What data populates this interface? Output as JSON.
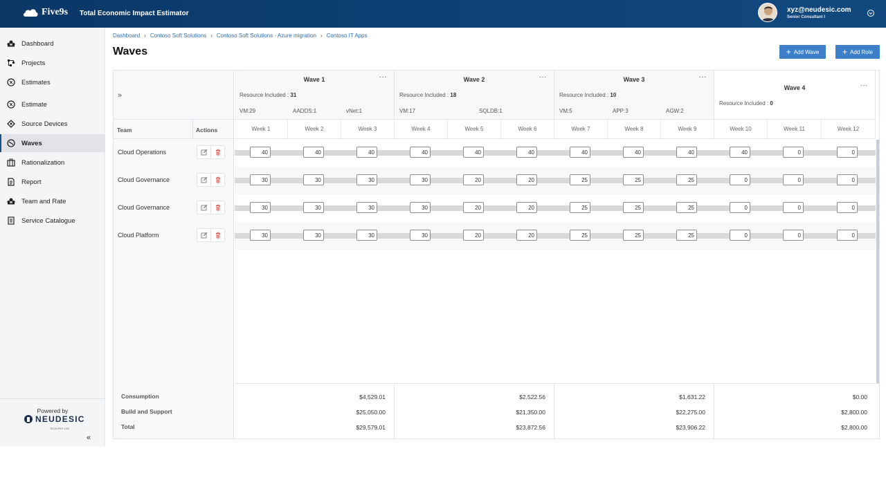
{
  "header": {
    "brand": "Five9s",
    "app_title": "Total Economic Impact Estimator",
    "user_email": "xyz@neudesic.com",
    "user_role": "Senior Consultant I"
  },
  "sidebar": {
    "items": [
      {
        "label": "Dashboard",
        "icon": "dashboard-icon"
      },
      {
        "label": "Projects",
        "icon": "projects-icon"
      },
      {
        "label": "Estimates",
        "icon": "estimates-icon"
      },
      {
        "label": "Estimate",
        "icon": "estimate-icon"
      },
      {
        "label": "Source Devices",
        "icon": "source-devices-icon"
      },
      {
        "label": "Waves",
        "icon": "waves-icon",
        "active": true
      },
      {
        "label": "Rationalization",
        "icon": "rationalization-icon"
      },
      {
        "label": "Report",
        "icon": "report-icon"
      },
      {
        "label": "Team and Rate",
        "icon": "team-icon"
      },
      {
        "label": "Service Catalogue",
        "icon": "catalogue-icon"
      }
    ],
    "powered_by": "Powered by",
    "brand_name": "NEUDESIC",
    "brand_sub": "TECH PVT LTD",
    "collapse": "«"
  },
  "breadcrumb": [
    "Dashboard",
    "Contoso Soft Solutions",
    "Contoso Soft Solutions - Azure migration",
    "Contoso IT Apps"
  ],
  "page_title": "Waves",
  "buttons": {
    "add_wave": "Add Wave",
    "add_role": "Add Role"
  },
  "grid": {
    "expand": "»",
    "team_header": "Team",
    "actions_header": "Actions",
    "waves": [
      {
        "title": "Wave 1",
        "resources_label": "Resource Included : ",
        "resources": "31",
        "breakdown": [
          "VM:29",
          "AADDS:1",
          "vNet:1"
        ]
      },
      {
        "title": "Wave 2",
        "resources_label": "Resource Included : ",
        "resources": "18",
        "breakdown": [
          "VM:17",
          "SQLDB:1"
        ]
      },
      {
        "title": "Wave 3",
        "resources_label": "Resource Included : ",
        "resources": "10",
        "breakdown": [
          "VM:5",
          "APP:3",
          "AGW:2"
        ]
      },
      {
        "title": "Wave 4",
        "resources_label": "Resource Included : ",
        "resources": "0",
        "breakdown": []
      }
    ],
    "more": "···",
    "weeks": [
      "Week 1",
      "Week 2",
      "Week 3",
      "Week 4",
      "Week 5",
      "Week 6",
      "Week 7",
      "Week 8",
      "Week 9",
      "Week 10",
      "Week 11",
      "Week 12"
    ],
    "rows": [
      {
        "team": "Cloud Operations",
        "values": [
          "40",
          "40",
          "40",
          "40",
          "40",
          "40",
          "40",
          "40",
          "40",
          "40",
          "0",
          "0"
        ]
      },
      {
        "team": "Cloud Governance",
        "values": [
          "30",
          "30",
          "30",
          "30",
          "20",
          "20",
          "25",
          "25",
          "25",
          "0",
          "0",
          "0"
        ]
      },
      {
        "team": "Cloud Governance",
        "values": [
          "30",
          "30",
          "30",
          "30",
          "20",
          "20",
          "25",
          "25",
          "25",
          "0",
          "0",
          "0"
        ]
      },
      {
        "team": "Cloud Platform",
        "values": [
          "30",
          "30",
          "30",
          "30",
          "20",
          "20",
          "25",
          "25",
          "25",
          "0",
          "0",
          "0"
        ]
      }
    ],
    "summary": {
      "labels": [
        "Consumption",
        "Build and Support",
        "Total"
      ],
      "columns": [
        [
          "$4,529.01",
          "$25,050.00",
          "$29,579.01"
        ],
        [
          "$2,522.56",
          "$21,350.00",
          "$23,872.56"
        ],
        [
          "$1,631.22",
          "$22,275.00",
          "$23,906.22"
        ],
        [
          "$0.00",
          "$2,800.00",
          "$2,800.00"
        ]
      ]
    }
  },
  "colors": {
    "header": "#0e4377",
    "accent": "#3d7fc9",
    "delete": "#d9534f",
    "link": "#2f6db3"
  }
}
